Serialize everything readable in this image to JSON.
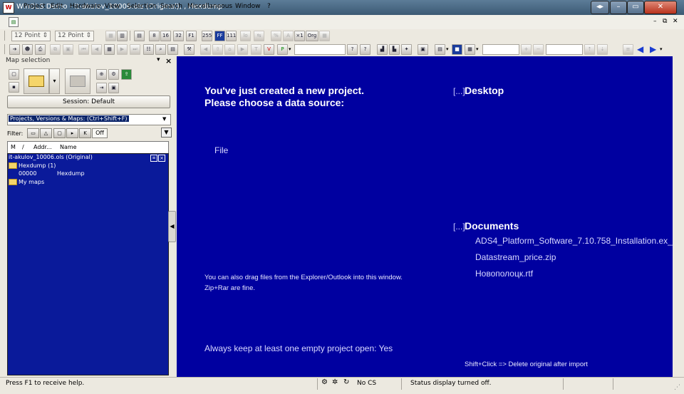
{
  "window": {
    "title": "WinOLS Demo - it-akulov_10006.ols (Original), , Hexdump",
    "app_icon": "winols-icon",
    "controls": [
      "◂▸",
      "–",
      "▭",
      "✕"
    ]
  },
  "menubar": {
    "items": [
      "Project",
      "Edit",
      "Hardware",
      "View",
      "Selection",
      "Search",
      "Miscellaneous",
      "Window",
      "?"
    ],
    "mdi_controls": [
      "–",
      "⧉",
      "✕"
    ]
  },
  "toolbar1": {
    "font_size_1": "12 Point",
    "font_size_2": "12 Point",
    "buttons": [
      "16",
      "32",
      "F1",
      "255",
      "FF",
      "111",
      "%",
      "A",
      "×1",
      "Org"
    ]
  },
  "toolbar2": {
    "buttons": [
      "?",
      "?"
    ]
  },
  "panel": {
    "header": "Map selection",
    "session_button": "Session: Default",
    "combo_value": "Projects, Versions & Maps:  (Ctrl+Shift+F)",
    "filter_label": "Filter:",
    "filter_off": "Off",
    "columns": [
      "M",
      "/",
      "Addr...",
      "Name"
    ],
    "tree": {
      "root": "it-akulov_10006.ols (Original)",
      "folder1": "Hexdump (1)",
      "item_addr": "00000",
      "item_name": "Hexdump",
      "folder2": "My maps"
    }
  },
  "main": {
    "headline1": "You've just created a new project.",
    "headline2": "Please choose a data source:",
    "file_option": "File",
    "drag_hint1": "You can also drag files from the Explorer/Outlook into this window.",
    "drag_hint2": "Zip+Rar are fine.",
    "keep_open": "Always keep at least one empty project open: Yes",
    "desktop_bracket": "[...]",
    "desktop_label": "Desktop",
    "documents_bracket": "[...]",
    "documents_label": "Documents",
    "documents": [
      "ADS4_Platform_Software_7.10.758_Installation.ex_",
      "Datastream_price.zip",
      "Новополоцк.rtf"
    ],
    "shift_hint": "Shift+Click => Delete original after import"
  },
  "statusbar": {
    "help": "Press F1 to receive help.",
    "cs": "No CS",
    "display": "Status display turned off."
  },
  "colors": {
    "main_bg": "#0000a0",
    "tree_bg": "#0a1a9a",
    "titlebar": "#3c5a74"
  }
}
